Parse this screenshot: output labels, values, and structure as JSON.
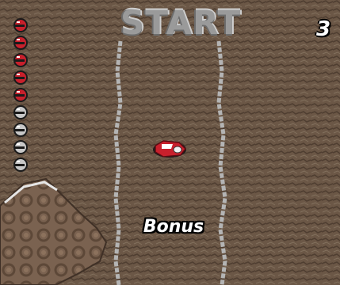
{
  "hud": {
    "start_label": "START",
    "lap_number": "3",
    "bonus_label": "Bonus",
    "lives_remaining": 5,
    "lives_total": 9
  },
  "colors": {
    "dirt": "#6b5746",
    "dirt_dark": "#4f3e31",
    "track_edge": "#b4b4b4",
    "player_car": "#c8202c",
    "life_full": "#c8202c",
    "life_empty": "#c8c8c8"
  },
  "sprites": {
    "player": "red-race-car",
    "life_marker": "helmet-icon",
    "rock_area": "rocky-outcrop"
  }
}
